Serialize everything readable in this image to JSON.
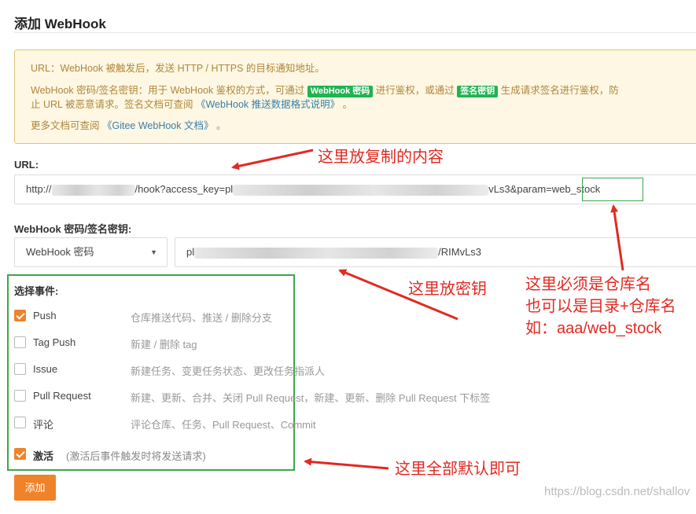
{
  "page": {
    "title": "添加 WebHook"
  },
  "notice": {
    "line1": "URL：WebHook 被触发后，发送 HTTP / HTTPS 的目标通知地址。",
    "line2_a": "WebHook 密码/签名密钥：用于 WebHook 鉴权的方式，可通过",
    "badge_password": "WebHook 密码",
    "line2_b": "进行鉴权，或通过",
    "badge_signature": "签名密钥",
    "line2_c": "生成请求签名进行鉴权，防",
    "line3_a": "止 URL 被恶意请求。签名文档可查阅",
    "line3_link": "《WebHook 推送数据格式说明》",
    "line3_end": "。",
    "line4_a": "更多文档可查阅",
    "line4_link": "《Gitee WebHook 文档》",
    "line4_end": "。"
  },
  "url": {
    "label": "URL:",
    "part_prefix": "http://",
    "part_mid": "/hook?access_key=pl",
    "part_tail": "vLs3&param=",
    "part_highlight": "web_stock"
  },
  "secret": {
    "label": "WebHook 密码/签名密钥:",
    "type_selected": "WebHook 密码",
    "value_prefix": "pl",
    "value_suffix": "/RIMvLs3"
  },
  "events": {
    "title": "选择事件:",
    "items": [
      {
        "name": "Push",
        "desc": "仓库推送代码、推送 / 删除分支",
        "checked": true
      },
      {
        "name": "Tag Push",
        "desc": "新建 / 删除 tag",
        "checked": false
      },
      {
        "name": "Issue",
        "desc": "新建任务、变更任务状态、更改任务指派人",
        "checked": false
      },
      {
        "name": "Pull Request",
        "desc": "新建、更新、合并、关闭 Pull Request，新建、更新、删除 Pull Request 下标签",
        "checked": false
      },
      {
        "name": "评论",
        "desc": "评论仓库、任务、Pull Request、Commit",
        "checked": false
      }
    ],
    "activate_label": "激活",
    "activate_hint": "(激活后事件触发时将发送请求)",
    "activate_checked": true
  },
  "submit_label": "添加",
  "annotations": {
    "url": "这里放复制的内容",
    "secret": "这里放密钥",
    "repo_lines": [
      "这里必须是仓库名",
      "也可以是目录+仓库名",
      "如：aaa/web_stock"
    ],
    "events": "这里全部默认即可"
  },
  "watermark": "https://blog.csdn.net/shallov",
  "colors": {
    "accent": "#f0822a",
    "annotation": "#e12a22",
    "highlight_box": "#3aa84a",
    "badge": "#21b351"
  }
}
